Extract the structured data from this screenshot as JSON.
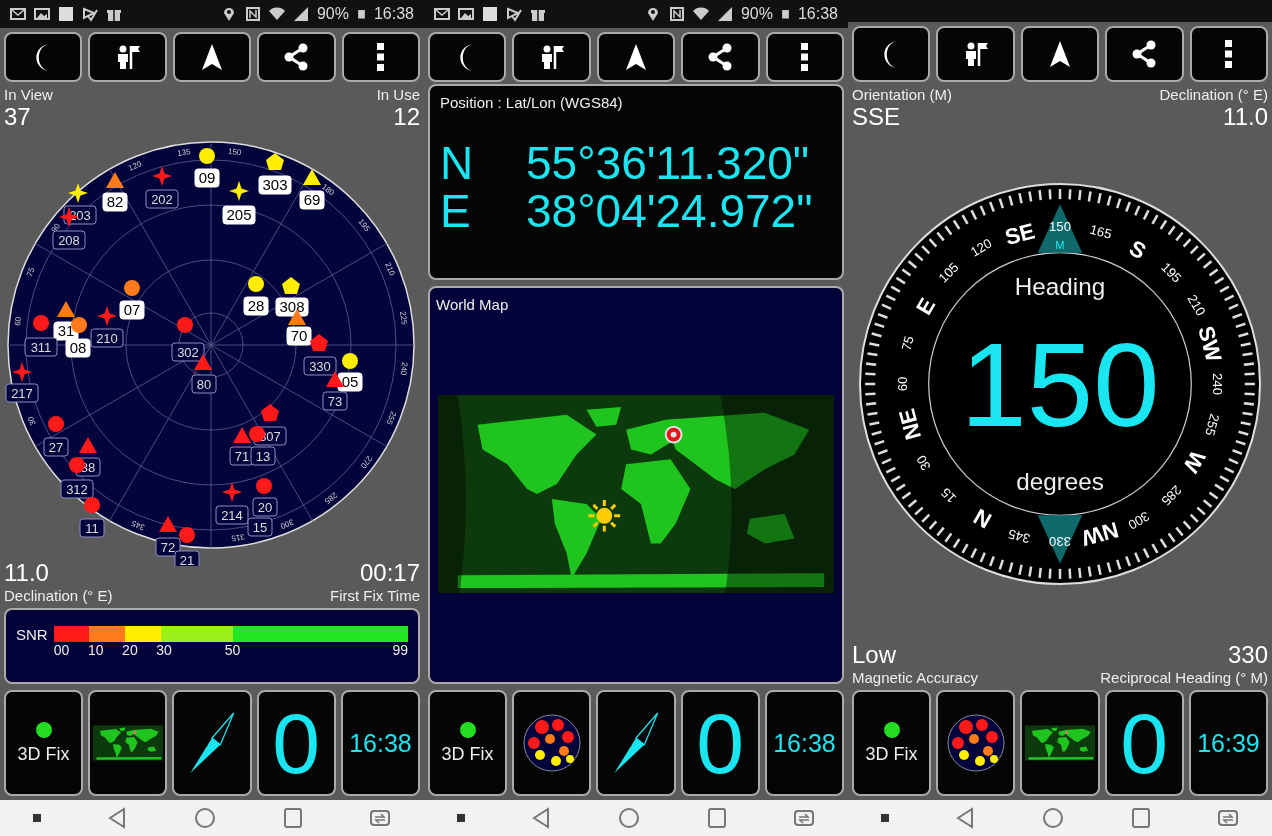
{
  "screens": [
    {
      "status_bar": {
        "battery": "90%",
        "time": "16:38"
      },
      "toolbar": [
        {
          "kind": "moon"
        },
        {
          "kind": "person"
        },
        {
          "kind": "arrow"
        },
        {
          "kind": "share"
        },
        {
          "kind": "more"
        }
      ],
      "content": {
        "kind": "sky",
        "in_view": {
          "label": "In View",
          "value": "37"
        },
        "in_use": {
          "label": "In Use",
          "value": "12"
        },
        "azimuth_labels": [
          "135",
          "150",
          "180",
          "195",
          "210",
          "225",
          "240",
          "255",
          "270",
          "285",
          "300",
          "315",
          "345",
          "30",
          "60",
          "75",
          "90",
          "120"
        ],
        "satellites": [
          {
            "id": "09",
            "kind": "circle",
            "color": "#ffee00",
            "used": true
          },
          {
            "id": "82",
            "kind": "triangle",
            "color": "#ff7a1a",
            "used": true
          },
          {
            "id": "202",
            "kind": "star",
            "color": "#ff1a1a",
            "used": false
          },
          {
            "id": "205",
            "kind": "star",
            "color": "#ffee00",
            "used": true
          },
          {
            "id": "303",
            "kind": "pentagon",
            "color": "#ffee00",
            "used": true
          },
          {
            "id": "69",
            "kind": "triangle",
            "color": "#ffee00",
            "used": true
          },
          {
            "id": "203",
            "kind": "star",
            "color": "#ffee00",
            "used": false
          },
          {
            "id": "208",
            "kind": "star",
            "color": "#ff1a1a",
            "used": false
          },
          {
            "id": "07",
            "kind": "circle",
            "color": "#ff7a1a",
            "used": true
          },
          {
            "id": "210",
            "kind": "star",
            "color": "#ff1a1a",
            "used": false
          },
          {
            "id": "31",
            "kind": "triangle",
            "color": "#ff7a1a",
            "used": true
          },
          {
            "id": "311",
            "kind": "circle",
            "color": "#ff1a1a",
            "used": false
          },
          {
            "id": "08",
            "kind": "circle",
            "color": "#ff7a1a",
            "used": true
          },
          {
            "id": "28",
            "kind": "circle",
            "color": "#ffee00",
            "used": true
          },
          {
            "id": "308",
            "kind": "pentagon",
            "color": "#ffee00",
            "used": true
          },
          {
            "id": "70",
            "kind": "triangle",
            "color": "#ff7a1a",
            "used": true
          },
          {
            "id": "330",
            "kind": "pentagon",
            "color": "#ff1a1a",
            "used": false
          },
          {
            "id": "05",
            "kind": "circle",
            "color": "#ffee00",
            "used": true
          },
          {
            "id": "73",
            "kind": "triangle",
            "color": "#ff1a1a",
            "used": false
          },
          {
            "id": "302",
            "kind": "circle",
            "color": "#ff1a1a",
            "used": false
          },
          {
            "id": "80",
            "kind": "triangle",
            "color": "#ff1a1a",
            "used": false
          },
          {
            "id": "217",
            "kind": "star",
            "color": "#ff1a1a",
            "used": false
          },
          {
            "id": "27",
            "kind": "circle",
            "color": "#ff1a1a",
            "used": false
          },
          {
            "id": "38",
            "kind": "triangle",
            "color": "#ff1a1a",
            "used": false
          },
          {
            "id": "312",
            "kind": "circle",
            "color": "#ff1a1a",
            "used": false
          },
          {
            "id": "11",
            "kind": "circle",
            "color": "#ff1a1a",
            "used": false
          },
          {
            "id": "71",
            "kind": "triangle",
            "color": "#ff1a1a",
            "used": false
          },
          {
            "id": "307",
            "kind": "pentagon",
            "color": "#ff1a1a",
            "used": false
          },
          {
            "id": "13",
            "kind": "circle",
            "color": "#ff1a1a",
            "used": false
          },
          {
            "id": "214",
            "kind": "star",
            "color": "#ff1a1a",
            "used": false
          },
          {
            "id": "20",
            "kind": "circle",
            "color": "#ff1a1a",
            "used": false
          },
          {
            "id": "15",
            "used": false
          },
          {
            "id": "72",
            "kind": "triangle",
            "color": "#ff1a1a",
            "used": false
          },
          {
            "id": "21",
            "kind": "circle",
            "color": "#ff1a1a",
            "used": false
          }
        ],
        "declination": {
          "value": "11.0",
          "label": "Declination (° E)"
        },
        "first_fix": {
          "value": "00:17",
          "label": "First Fix Time"
        },
        "snr": {
          "label": "SNR",
          "segments": [
            {
              "color": "#ff1a1a"
            },
            {
              "color": "#ff7a1a"
            },
            {
              "color": "#ffee00"
            },
            {
              "color": "#9cf01a"
            },
            {
              "color": "#22e622"
            }
          ],
          "ticks": [
            "00",
            "10",
            "20",
            "30",
            "50",
            "99"
          ]
        }
      },
      "tiles": [
        {
          "kind": "fix",
          "label": "3D Fix"
        },
        {
          "kind": "map"
        },
        {
          "kind": "compass"
        },
        {
          "kind": "count",
          "value": "0"
        },
        {
          "kind": "clock",
          "value": "16:38"
        }
      ]
    },
    {
      "status_bar": {
        "battery": "90%",
        "time": "16:38"
      },
      "toolbar": [
        {
          "kind": "moon"
        },
        {
          "kind": "person"
        },
        {
          "kind": "arrow"
        },
        {
          "kind": "share"
        },
        {
          "kind": "more"
        }
      ],
      "content": {
        "kind": "position",
        "title": "Position : Lat/Lon (WGS84)",
        "rows": [
          {
            "hemisphere": "N",
            "value": "55°36'11.320\""
          },
          {
            "hemisphere": "E",
            "value": "38°04'24.972\""
          }
        ],
        "map_title": "World Map"
      },
      "tiles": [
        {
          "kind": "fix",
          "label": "3D Fix"
        },
        {
          "kind": "sky"
        },
        {
          "kind": "compass"
        },
        {
          "kind": "count",
          "value": "0"
        },
        {
          "kind": "clock",
          "value": "16:38"
        }
      ]
    },
    {
      "toolbar": [
        {
          "kind": "moon"
        },
        {
          "kind": "person"
        },
        {
          "kind": "arrow"
        },
        {
          "kind": "share"
        },
        {
          "kind": "more"
        }
      ],
      "content": {
        "kind": "compass",
        "orientation": {
          "label": "Orientation (M)",
          "value": "SSE"
        },
        "declination": {
          "label": "Declination (° E)",
          "value": "11.0"
        },
        "dial_labels": [
          {
            "text": "N",
            "kind": "cardinal"
          },
          {
            "text": "15",
            "kind": "degree"
          },
          {
            "text": "30",
            "kind": "degree"
          },
          {
            "text": "NE",
            "kind": "cardinal"
          },
          {
            "text": "60",
            "kind": "degree"
          },
          {
            "text": "75",
            "kind": "degree"
          },
          {
            "text": "E",
            "kind": "cardinal"
          },
          {
            "text": "105",
            "kind": "degree"
          },
          {
            "text": "120",
            "kind": "degree"
          },
          {
            "text": "SE",
            "kind": "cardinal"
          },
          {
            "text": "150",
            "kind": "degree"
          },
          {
            "text": "165",
            "kind": "degree"
          },
          {
            "text": "S",
            "kind": "cardinal"
          },
          {
            "text": "195",
            "kind": "degree"
          },
          {
            "text": "210",
            "kind": "degree"
          },
          {
            "text": "SW",
            "kind": "cardinal"
          },
          {
            "text": "240",
            "kind": "degree"
          },
          {
            "text": "255",
            "kind": "degree"
          },
          {
            "text": "W",
            "kind": "cardinal"
          },
          {
            "text": "285",
            "kind": "degree"
          },
          {
            "text": "300",
            "kind": "degree"
          },
          {
            "text": "NW",
            "kind": "cardinal"
          },
          {
            "text": "330",
            "kind": "degree"
          },
          {
            "text": "345",
            "kind": "degree"
          }
        ],
        "marker_label": "M",
        "heading_label": "Heading",
        "heading": "150",
        "unit": "degrees",
        "accuracy": {
          "value": "Low",
          "label": "Magnetic Accuracy"
        },
        "reciprocal": {
          "value": "330",
          "label": "Reciprocal Heading (° M)"
        }
      },
      "tiles": [
        {
          "kind": "fix",
          "label": "3D Fix"
        },
        {
          "kind": "sky"
        },
        {
          "kind": "map"
        },
        {
          "kind": "count",
          "value": "0"
        },
        {
          "kind": "clock",
          "value": "16:39"
        }
      ]
    }
  ],
  "nav_bar": [
    {
      "kind": "dot"
    },
    {
      "kind": "back"
    },
    {
      "kind": "home"
    },
    {
      "kind": "recent"
    },
    {
      "kind": "switch"
    }
  ]
}
